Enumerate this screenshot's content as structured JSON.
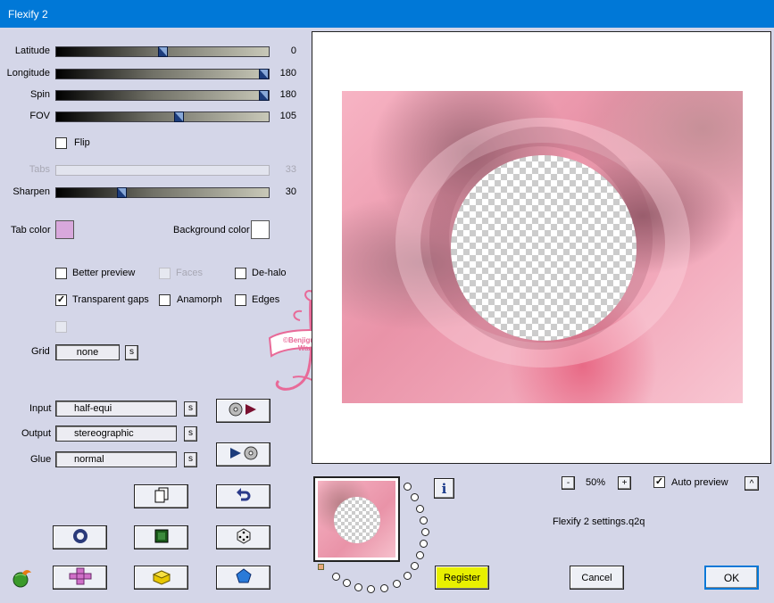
{
  "window": {
    "title": "Flexify 2"
  },
  "sliders": [
    {
      "label": "Latitude",
      "value": "0",
      "fraction": 0.5
    },
    {
      "label": "Longitude",
      "value": "180",
      "fraction": 1.0
    },
    {
      "label": "Spin",
      "value": "180",
      "fraction": 1.0
    },
    {
      "label": "FOV",
      "value": "105",
      "fraction": 0.58
    },
    {
      "label": "Tabs",
      "value": "33",
      "fraction": 0.0,
      "disabled": true
    },
    {
      "label": "Sharpen",
      "value": "30",
      "fraction": 0.3
    }
  ],
  "flip": {
    "label": "Flip",
    "checked": false
  },
  "colors": {
    "tab_color_label": "Tab color",
    "tab_color": "#d8a8dc",
    "background_color_label": "Background color",
    "background_color": "#ffffff",
    "accent": "#0078d7",
    "register_button": "#e8f000"
  },
  "options": {
    "better_preview": {
      "label": "Better preview",
      "checked": false
    },
    "faces": {
      "label": "Faces",
      "checked": false,
      "disabled": true
    },
    "de_halo": {
      "label": "De-halo",
      "checked": false
    },
    "transparent_gaps": {
      "label": "Transparent gaps",
      "checked": true
    },
    "anamorph": {
      "label": "Anamorph",
      "checked": false
    },
    "edges": {
      "label": "Edges",
      "checked": false
    }
  },
  "grid": {
    "label": "Grid",
    "value": "none",
    "s": "s"
  },
  "projection": {
    "input_label": "Input",
    "input_value": "half-equi",
    "output_label": "Output",
    "output_value": "stereographic",
    "glue_label": "Glue",
    "glue_value": "normal",
    "s": "s"
  },
  "zoom": {
    "minus": "-",
    "value": "50%",
    "plus": "+"
  },
  "auto_preview": {
    "label": "Auto preview",
    "checked": true,
    "collapse": "^"
  },
  "settings_file": "Flexify 2 settings.q2q",
  "info": "i",
  "buttons": {
    "register": "Register",
    "cancel": "Cancel",
    "ok": "OK"
  },
  "watermark": {
    "text": "©Benjigurien\nWaa"
  },
  "icons": {
    "copy": "copy-icon",
    "undo": "undo-icon",
    "ring": "ring-icon",
    "frame": "frame-icon",
    "dice": "dice-icon",
    "plus": "plus-grid-icon",
    "brick": "brick-icon",
    "gem": "pentagon-icon",
    "swap_in": "disc-to-play-icon",
    "swap_out": "play-to-disc-icon",
    "logo": "flaming-globe-icon"
  }
}
